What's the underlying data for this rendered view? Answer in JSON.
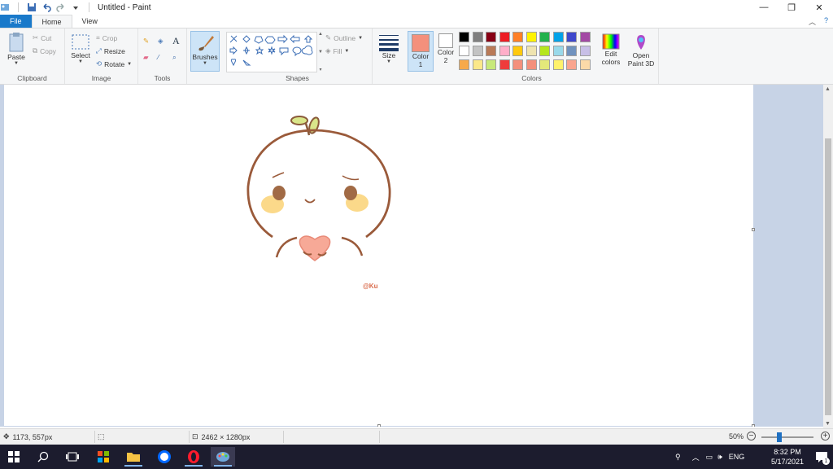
{
  "app": {
    "title": "Untitled - Paint"
  },
  "tabs": {
    "file": "File",
    "home": "Home",
    "view": "View"
  },
  "ribbon": {
    "clipboard": {
      "label": "Clipboard",
      "paste": "Paste",
      "cut": "Cut",
      "copy": "Copy"
    },
    "image": {
      "label": "Image",
      "select": "Select",
      "crop": "Crop",
      "resize": "Resize",
      "rotate": "Rotate"
    },
    "tools": {
      "label": "Tools"
    },
    "brushes": {
      "label": "Brushes"
    },
    "shapes": {
      "label": "Shapes",
      "outline": "Outline",
      "fill": "Fill"
    },
    "size": {
      "label": "Size"
    },
    "colors": {
      "label": "Colors",
      "color1": "Color\n1",
      "color1_line1": "Color",
      "color1_line2": "1",
      "color2_line1": "Color",
      "color2_line2": "2",
      "color1_value": "#f4907c",
      "color2_value": "#ffffff",
      "edit_line1": "Edit",
      "edit_line2": "colors",
      "palette_row1": [
        "#000000",
        "#7f7f7f",
        "#880015",
        "#ed1c24",
        "#ff7f27",
        "#fff200",
        "#22b14c",
        "#00a2e8",
        "#3f48cc",
        "#a349a4"
      ],
      "palette_row2": [
        "#ffffff",
        "#c3c3c3",
        "#b97a57",
        "#ffaec9",
        "#ffc90e",
        "#efe4b0",
        "#b5e61d",
        "#99d9ea",
        "#7092be",
        "#c8bfe7"
      ],
      "palette_row3": [
        "#f7a94a",
        "#fbe88a",
        "#c7e97a",
        "#ee3b3b",
        "#f4907c",
        "#f4907c",
        "#e3e87a",
        "#fff26b",
        "#f9a58f",
        "#fbd9a8"
      ]
    },
    "paint3d": {
      "line1": "Open",
      "line2": "Paint 3D"
    }
  },
  "drawing": {
    "signature": "@Ku"
  },
  "status": {
    "cursor": "1173, 557px",
    "dimensions": "2462 × 1280px",
    "zoom": "50%",
    "zoom_level": 0.5
  },
  "taskbar": {
    "lang": "ENG",
    "time": "8:32 PM",
    "date": "5/17/2021",
    "notification_count": "1"
  }
}
